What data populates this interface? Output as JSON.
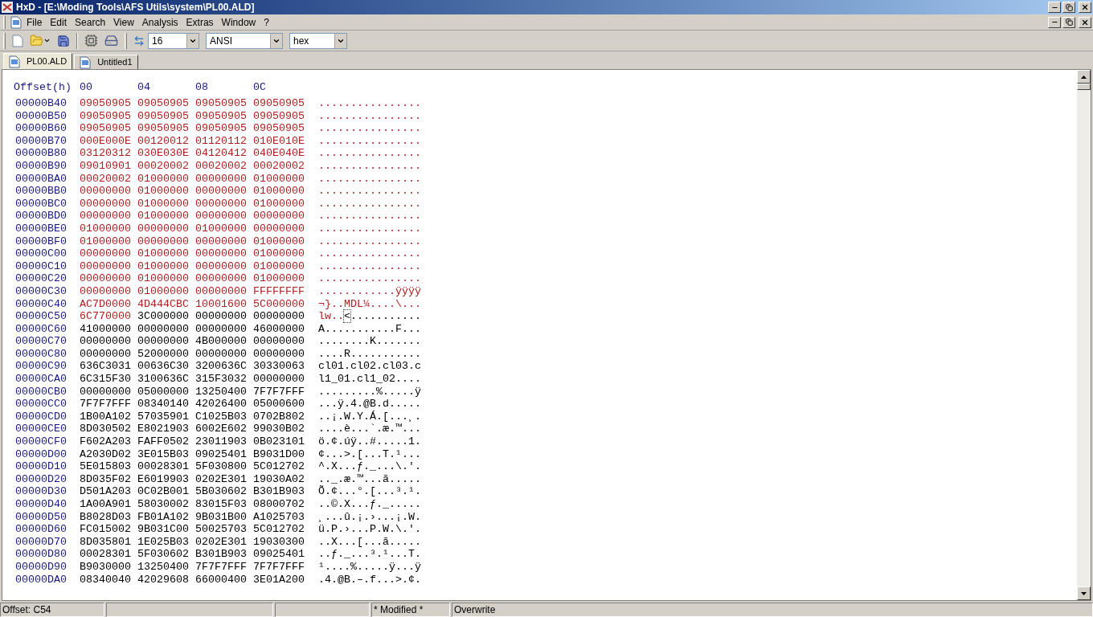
{
  "window": {
    "title": "HxD - [E:\\Moding Tools\\AFS Utils\\system\\PL00.ALD]"
  },
  "menu": [
    "File",
    "Edit",
    "Search",
    "View",
    "Analysis",
    "Extras",
    "Window",
    "?"
  ],
  "toolbar": {
    "bytes_per_row": "16",
    "charset": "ANSI",
    "display": "hex"
  },
  "tabs": [
    {
      "label": "PL00.ALD",
      "selected": true
    },
    {
      "label": "Untitled1",
      "selected": false
    }
  ],
  "hex_view": {
    "header": {
      "offset": "Offset(h)",
      "columns": [
        "00",
        "04",
        "08",
        "0C"
      ]
    },
    "rows": [
      {
        "offset": "00000B40",
        "groups": [
          {
            "hex": "09050905",
            "modified": true
          },
          {
            "hex": "09050905",
            "modified": true
          },
          {
            "hex": "09050905",
            "modified": true
          },
          {
            "hex": "09050905",
            "modified": true
          }
        ],
        "ascii": [
          {
            "text": "................",
            "modified": true
          }
        ]
      },
      {
        "offset": "00000B50",
        "groups": [
          {
            "hex": "09050905",
            "modified": true
          },
          {
            "hex": "09050905",
            "modified": true
          },
          {
            "hex": "09050905",
            "modified": true
          },
          {
            "hex": "09050905",
            "modified": true
          }
        ],
        "ascii": [
          {
            "text": "................",
            "modified": true
          }
        ]
      },
      {
        "offset": "00000B60",
        "groups": [
          {
            "hex": "09050905",
            "modified": true
          },
          {
            "hex": "09050905",
            "modified": true
          },
          {
            "hex": "09050905",
            "modified": true
          },
          {
            "hex": "09050905",
            "modified": true
          }
        ],
        "ascii": [
          {
            "text": "................",
            "modified": true
          }
        ]
      },
      {
        "offset": "00000B70",
        "groups": [
          {
            "hex": "000E000E",
            "modified": true
          },
          {
            "hex": "00120012",
            "modified": true
          },
          {
            "hex": "01120112",
            "modified": true
          },
          {
            "hex": "010E010E",
            "modified": true
          }
        ],
        "ascii": [
          {
            "text": "................",
            "modified": true
          }
        ]
      },
      {
        "offset": "00000B80",
        "groups": [
          {
            "hex": "03120312",
            "modified": true
          },
          {
            "hex": "030E030E",
            "modified": true
          },
          {
            "hex": "04120412",
            "modified": true
          },
          {
            "hex": "040E040E",
            "modified": true
          }
        ],
        "ascii": [
          {
            "text": "................",
            "modified": true
          }
        ]
      },
      {
        "offset": "00000B90",
        "groups": [
          {
            "hex": "09010901",
            "modified": true
          },
          {
            "hex": "00020002",
            "modified": true
          },
          {
            "hex": "00020002",
            "modified": true
          },
          {
            "hex": "00020002",
            "modified": true
          }
        ],
        "ascii": [
          {
            "text": "................",
            "modified": true
          }
        ]
      },
      {
        "offset": "00000BA0",
        "groups": [
          {
            "hex": "00020002",
            "modified": true
          },
          {
            "hex": "01000000",
            "modified": true
          },
          {
            "hex": "00000000",
            "modified": true
          },
          {
            "hex": "01000000",
            "modified": true
          }
        ],
        "ascii": [
          {
            "text": "................",
            "modified": true
          }
        ]
      },
      {
        "offset": "00000BB0",
        "groups": [
          {
            "hex": "00000000",
            "modified": true
          },
          {
            "hex": "01000000",
            "modified": true
          },
          {
            "hex": "00000000",
            "modified": true
          },
          {
            "hex": "01000000",
            "modified": true
          }
        ],
        "ascii": [
          {
            "text": "................",
            "modified": true
          }
        ]
      },
      {
        "offset": "00000BC0",
        "groups": [
          {
            "hex": "00000000",
            "modified": true
          },
          {
            "hex": "01000000",
            "modified": true
          },
          {
            "hex": "00000000",
            "modified": true
          },
          {
            "hex": "01000000",
            "modified": true
          }
        ],
        "ascii": [
          {
            "text": "................",
            "modified": true
          }
        ]
      },
      {
        "offset": "00000BD0",
        "groups": [
          {
            "hex": "00000000",
            "modified": true
          },
          {
            "hex": "01000000",
            "modified": true
          },
          {
            "hex": "00000000",
            "modified": true
          },
          {
            "hex": "00000000",
            "modified": true
          }
        ],
        "ascii": [
          {
            "text": "................",
            "modified": true
          }
        ]
      },
      {
        "offset": "00000BE0",
        "groups": [
          {
            "hex": "01000000",
            "modified": true
          },
          {
            "hex": "00000000",
            "modified": true
          },
          {
            "hex": "01000000",
            "modified": true
          },
          {
            "hex": "00000000",
            "modified": true
          }
        ],
        "ascii": [
          {
            "text": "................",
            "modified": true
          }
        ]
      },
      {
        "offset": "00000BF0",
        "groups": [
          {
            "hex": "01000000",
            "modified": true
          },
          {
            "hex": "00000000",
            "modified": true
          },
          {
            "hex": "00000000",
            "modified": true
          },
          {
            "hex": "01000000",
            "modified": true
          }
        ],
        "ascii": [
          {
            "text": "................",
            "modified": true
          }
        ]
      },
      {
        "offset": "00000C00",
        "groups": [
          {
            "hex": "00000000",
            "modified": true
          },
          {
            "hex": "01000000",
            "modified": true
          },
          {
            "hex": "00000000",
            "modified": true
          },
          {
            "hex": "01000000",
            "modified": true
          }
        ],
        "ascii": [
          {
            "text": "................",
            "modified": true
          }
        ]
      },
      {
        "offset": "00000C10",
        "groups": [
          {
            "hex": "00000000",
            "modified": true
          },
          {
            "hex": "01000000",
            "modified": true
          },
          {
            "hex": "00000000",
            "modified": true
          },
          {
            "hex": "01000000",
            "modified": true
          }
        ],
        "ascii": [
          {
            "text": "................",
            "modified": true
          }
        ]
      },
      {
        "offset": "00000C20",
        "groups": [
          {
            "hex": "00000000",
            "modified": true
          },
          {
            "hex": "01000000",
            "modified": true
          },
          {
            "hex": "00000000",
            "modified": true
          },
          {
            "hex": "01000000",
            "modified": true
          }
        ],
        "ascii": [
          {
            "text": "................",
            "modified": true
          }
        ]
      },
      {
        "offset": "00000C30",
        "groups": [
          {
            "hex": "00000000",
            "modified": true
          },
          {
            "hex": "01000000",
            "modified": true
          },
          {
            "hex": "00000000",
            "modified": true
          },
          {
            "hex": "FFFFFFFF",
            "modified": true
          }
        ],
        "ascii": [
          {
            "text": "............ÿÿÿÿ",
            "modified": true
          }
        ]
      },
      {
        "offset": "00000C40",
        "groups": [
          {
            "hex": "AC7D0000",
            "modified": true
          },
          {
            "hex": "4D444CBC",
            "modified": true
          },
          {
            "hex": "10001600",
            "modified": true
          },
          {
            "hex": "5C000000",
            "modified": true
          }
        ],
        "ascii": [
          {
            "text": "¬}..MDL¼....\\...",
            "modified": true
          }
        ]
      },
      {
        "offset": "00000C50",
        "groups": [
          {
            "hex": "6C770000",
            "modified": true
          },
          {
            "hex": "3C000000",
            "modified": false
          },
          {
            "hex": "00000000",
            "modified": false
          },
          {
            "hex": "00000000",
            "modified": false
          }
        ],
        "ascii": [
          {
            "text": "lw..",
            "modified": true
          },
          {
            "text": "<",
            "modified": false,
            "cursor": true
          },
          {
            "text": "...........",
            "modified": false
          }
        ]
      },
      {
        "offset": "00000C60",
        "groups": [
          {
            "hex": "41000000",
            "modified": false
          },
          {
            "hex": "00000000",
            "modified": false
          },
          {
            "hex": "00000000",
            "modified": false
          },
          {
            "hex": "46000000",
            "modified": false
          }
        ],
        "ascii": [
          {
            "text": "A...........F...",
            "modified": false
          }
        ]
      },
      {
        "offset": "00000C70",
        "groups": [
          {
            "hex": "00000000",
            "modified": false
          },
          {
            "hex": "00000000",
            "modified": false
          },
          {
            "hex": "4B000000",
            "modified": false
          },
          {
            "hex": "00000000",
            "modified": false
          }
        ],
        "ascii": [
          {
            "text": "........K.......",
            "modified": false
          }
        ]
      },
      {
        "offset": "00000C80",
        "groups": [
          {
            "hex": "00000000",
            "modified": false
          },
          {
            "hex": "52000000",
            "modified": false
          },
          {
            "hex": "00000000",
            "modified": false
          },
          {
            "hex": "00000000",
            "modified": false
          }
        ],
        "ascii": [
          {
            "text": "....R...........",
            "modified": false
          }
        ]
      },
      {
        "offset": "00000C90",
        "groups": [
          {
            "hex": "636C3031",
            "modified": false
          },
          {
            "hex": "00636C30",
            "modified": false
          },
          {
            "hex": "3200636C",
            "modified": false
          },
          {
            "hex": "30330063",
            "modified": false
          }
        ],
        "ascii": [
          {
            "text": "cl01.cl02.cl03.c",
            "modified": false
          }
        ]
      },
      {
        "offset": "00000CA0",
        "groups": [
          {
            "hex": "6C315F30",
            "modified": false
          },
          {
            "hex": "3100636C",
            "modified": false
          },
          {
            "hex": "315F3032",
            "modified": false
          },
          {
            "hex": "00000000",
            "modified": false
          }
        ],
        "ascii": [
          {
            "text": "l1_01.cl1_02....",
            "modified": false
          }
        ]
      },
      {
        "offset": "00000CB0",
        "groups": [
          {
            "hex": "00000000",
            "modified": false
          },
          {
            "hex": "05000000",
            "modified": false
          },
          {
            "hex": "13250400",
            "modified": false
          },
          {
            "hex": "7F7F7FFF",
            "modified": false
          }
        ],
        "ascii": [
          {
            "text": ".........%.....ÿ",
            "modified": false
          }
        ]
      },
      {
        "offset": "00000CC0",
        "groups": [
          {
            "hex": "7F7F7FFF",
            "modified": false
          },
          {
            "hex": "08340140",
            "modified": false
          },
          {
            "hex": "42026400",
            "modified": false
          },
          {
            "hex": "05000600",
            "modified": false
          }
        ],
        "ascii": [
          {
            "text": "...ÿ.4.@B.d.....",
            "modified": false
          }
        ]
      },
      {
        "offset": "00000CD0",
        "groups": [
          {
            "hex": "1B00A102",
            "modified": false
          },
          {
            "hex": "57035901",
            "modified": false
          },
          {
            "hex": "C1025B03",
            "modified": false
          },
          {
            "hex": "0702B802",
            "modified": false
          }
        ],
        "ascii": [
          {
            "text": "..¡.W.Y.Á.[...¸.",
            "modified": false
          }
        ]
      },
      {
        "offset": "00000CE0",
        "groups": [
          {
            "hex": "8D030502",
            "modified": false
          },
          {
            "hex": "E8021903",
            "modified": false
          },
          {
            "hex": "6002E602",
            "modified": false
          },
          {
            "hex": "99030B02",
            "modified": false
          }
        ],
        "ascii": [
          {
            "text": "....è...`.æ.™...",
            "modified": false
          }
        ]
      },
      {
        "offset": "00000CF0",
        "groups": [
          {
            "hex": "F602A203",
            "modified": false
          },
          {
            "hex": "FAFF0502",
            "modified": false
          },
          {
            "hex": "23011903",
            "modified": false
          },
          {
            "hex": "0B023101",
            "modified": false
          }
        ],
        "ascii": [
          {
            "text": "ö.¢.úÿ..#.....1.",
            "modified": false
          }
        ]
      },
      {
        "offset": "00000D00",
        "groups": [
          {
            "hex": "A2030D02",
            "modified": false
          },
          {
            "hex": "3E015B03",
            "modified": false
          },
          {
            "hex": "09025401",
            "modified": false
          },
          {
            "hex": "B9031D00",
            "modified": false
          }
        ],
        "ascii": [
          {
            "text": "¢...>.[...T.¹...",
            "modified": false
          }
        ]
      },
      {
        "offset": "00000D10",
        "groups": [
          {
            "hex": "5E015803",
            "modified": false
          },
          {
            "hex": "00028301",
            "modified": false
          },
          {
            "hex": "5F030800",
            "modified": false
          },
          {
            "hex": "5C012702",
            "modified": false
          }
        ],
        "ascii": [
          {
            "text": "^.X...ƒ._...\\.'.",
            "modified": false
          }
        ]
      },
      {
        "offset": "00000D20",
        "groups": [
          {
            "hex": "8D035F02",
            "modified": false
          },
          {
            "hex": "E6019903",
            "modified": false
          },
          {
            "hex": "0202E301",
            "modified": false
          },
          {
            "hex": "19030A02",
            "modified": false
          }
        ],
        "ascii": [
          {
            "text": ".._.æ.™...ã.....",
            "modified": false
          }
        ]
      },
      {
        "offset": "00000D30",
        "groups": [
          {
            "hex": "D501A203",
            "modified": false
          },
          {
            "hex": "0C02B001",
            "modified": false
          },
          {
            "hex": "5B030602",
            "modified": false
          },
          {
            "hex": "B301B903",
            "modified": false
          }
        ],
        "ascii": [
          {
            "text": "Õ.¢...°.[...³.¹.",
            "modified": false
          }
        ]
      },
      {
        "offset": "00000D40",
        "groups": [
          {
            "hex": "1A00A901",
            "modified": false
          },
          {
            "hex": "58030002",
            "modified": false
          },
          {
            "hex": "83015F03",
            "modified": false
          },
          {
            "hex": "08000702",
            "modified": false
          }
        ],
        "ascii": [
          {
            "text": "..©.X...ƒ._.....",
            "modified": false
          }
        ]
      },
      {
        "offset": "00000D50",
        "groups": [
          {
            "hex": "B8028D03",
            "modified": false
          },
          {
            "hex": "FB01A102",
            "modified": false
          },
          {
            "hex": "9B031B00",
            "modified": false
          },
          {
            "hex": "A1025703",
            "modified": false
          }
        ],
        "ascii": [
          {
            "text": "¸...û.¡.›...¡.W.",
            "modified": false
          }
        ]
      },
      {
        "offset": "00000D60",
        "groups": [
          {
            "hex": "FC015002",
            "modified": false
          },
          {
            "hex": "9B031C00",
            "modified": false
          },
          {
            "hex": "50025703",
            "modified": false
          },
          {
            "hex": "5C012702",
            "modified": false
          }
        ],
        "ascii": [
          {
            "text": "ü.P.›...P.W.\\.'.",
            "modified": false
          }
        ]
      },
      {
        "offset": "00000D70",
        "groups": [
          {
            "hex": "8D035801",
            "modified": false
          },
          {
            "hex": "1E025B03",
            "modified": false
          },
          {
            "hex": "0202E301",
            "modified": false
          },
          {
            "hex": "19030300",
            "modified": false
          }
        ],
        "ascii": [
          {
            "text": "..X...[...ã.....",
            "modified": false
          }
        ]
      },
      {
        "offset": "00000D80",
        "groups": [
          {
            "hex": "00028301",
            "modified": false
          },
          {
            "hex": "5F030602",
            "modified": false
          },
          {
            "hex": "B301B903",
            "modified": false
          },
          {
            "hex": "09025401",
            "modified": false
          }
        ],
        "ascii": [
          {
            "text": "..ƒ._...³.¹...T.",
            "modified": false
          }
        ]
      },
      {
        "offset": "00000D90",
        "groups": [
          {
            "hex": "B9030000",
            "modified": false
          },
          {
            "hex": "13250400",
            "modified": false
          },
          {
            "hex": "7F7F7FFF",
            "modified": false
          },
          {
            "hex": "7F7F7FFF",
            "modified": false
          }
        ],
        "ascii": [
          {
            "text": "¹....%.....ÿ...ÿ",
            "modified": false
          }
        ]
      },
      {
        "offset": "00000DA0",
        "groups": [
          {
            "hex": "08340040",
            "modified": false
          },
          {
            "hex": "42029608",
            "modified": false
          },
          {
            "hex": "66000400",
            "modified": false
          },
          {
            "hex": "3E01A200",
            "modified": false
          }
        ],
        "ascii": [
          {
            "text": ".4.@B.–.f...>.¢.",
            "modified": false
          }
        ]
      }
    ]
  },
  "status_bar": {
    "offset": "Offset: C54",
    "modified": "* Modified *",
    "mode": "Overwrite"
  }
}
